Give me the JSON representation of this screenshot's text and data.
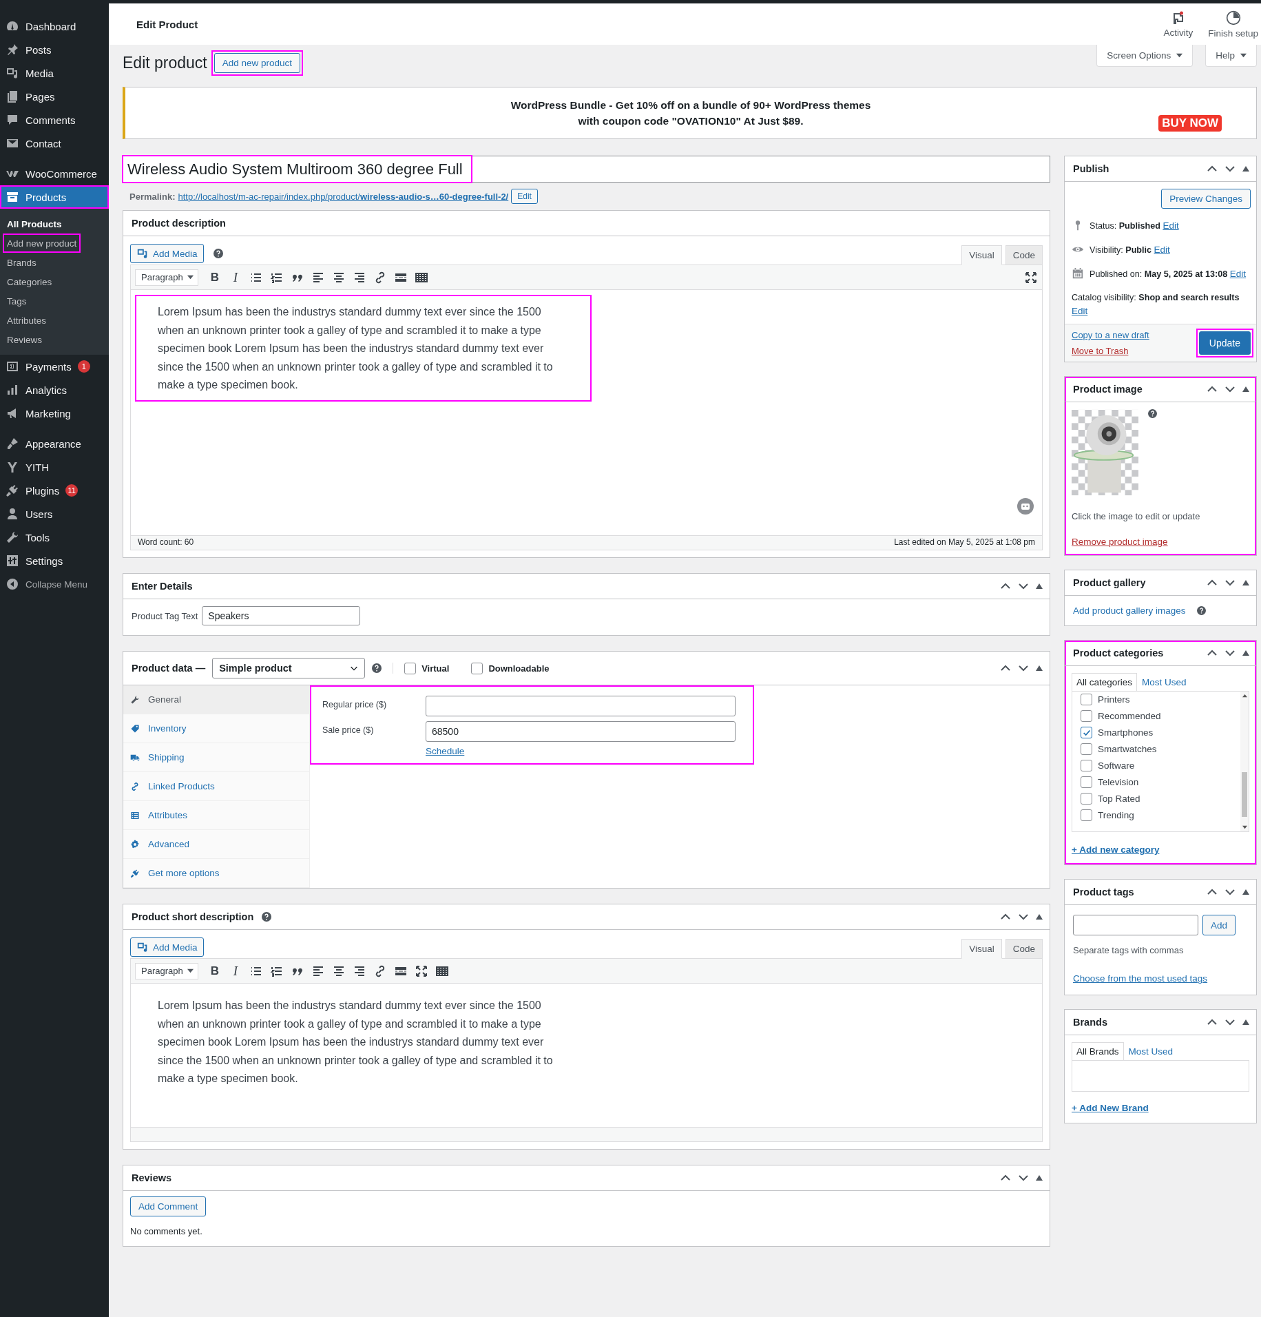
{
  "header": {
    "title": "Edit Product",
    "actions": [
      {
        "label": "Activity",
        "kind": "activity"
      },
      {
        "label": "Finish setup",
        "kind": "setup"
      }
    ]
  },
  "sidebar": {
    "items": [
      {
        "label": "Dashboard",
        "kind": "dashboard",
        "selected": false,
        "outlined": false
      },
      {
        "label": "Posts",
        "kind": "posts",
        "selected": false,
        "outlined": false
      },
      {
        "label": "Media",
        "kind": "media",
        "selected": false,
        "outlined": false
      },
      {
        "label": "Pages",
        "kind": "pages",
        "selected": false,
        "outlined": false
      },
      {
        "label": "Comments",
        "kind": "comments",
        "selected": false,
        "outlined": false
      },
      {
        "label": "Contact",
        "kind": "contact",
        "selected": false,
        "outlined": false
      },
      {
        "label": "WooCommerce",
        "kind": "woocommerce",
        "selected": false,
        "outlined": false
      },
      {
        "label": "Products",
        "kind": "products",
        "selected": true,
        "outlined": true,
        "submenu": [
          {
            "label": "All Products",
            "selected": true,
            "outlined": false
          },
          {
            "label": "Add new product",
            "selected": false,
            "outlined": true
          },
          {
            "label": "Brands",
            "selected": false,
            "outlined": false
          },
          {
            "label": "Categories",
            "selected": false,
            "outlined": false
          },
          {
            "label": "Tags",
            "selected": false,
            "outlined": false
          },
          {
            "label": "Attributes",
            "selected": false,
            "outlined": false
          },
          {
            "label": "Reviews",
            "selected": false,
            "outlined": false
          }
        ]
      },
      {
        "label": "Payments",
        "kind": "payments",
        "selected": false,
        "outlined": false,
        "badge": "1"
      },
      {
        "label": "Analytics",
        "kind": "analytics",
        "selected": false,
        "outlined": false
      },
      {
        "label": "Marketing",
        "kind": "marketing",
        "selected": false,
        "outlined": false
      },
      {
        "label": "Appearance",
        "kind": "appearance",
        "selected": false,
        "outlined": false
      },
      {
        "label": "YITH",
        "kind": "yith",
        "selected": false,
        "outlined": false
      },
      {
        "label": "Plugins",
        "kind": "plugins",
        "selected": false,
        "outlined": false,
        "badge": "11"
      },
      {
        "label": "Users",
        "kind": "users",
        "selected": false,
        "outlined": false
      },
      {
        "label": "Tools",
        "kind": "tools",
        "selected": false,
        "outlined": false
      },
      {
        "label": "Settings",
        "kind": "settings",
        "selected": false,
        "outlined": false
      },
      {
        "label": "Collapse Menu",
        "kind": "collapse",
        "selected": false,
        "outlined": false
      }
    ]
  },
  "page": {
    "heading": "Edit product",
    "add_button": "Add new product",
    "add_button_outlined": true,
    "screen_options": "Screen Options",
    "help": "Help"
  },
  "banner": {
    "line_1": "WordPress Bundle - Get 10% off on a bundle of 90+ WordPress themes",
    "line_2": "with coupon code \"OVATION10\" At Just $89.",
    "button": "BUY NOW"
  },
  "title_field": {
    "value": "Wireless Audio System Multiroom 360 degree Full",
    "outlined": true
  },
  "permalink": {
    "label": "Permalink:",
    "url": "http://localhost/m-ac-repair/index.php/product/**wireless-audio-s…60-degree-full-2/**",
    "button": "Edit"
  },
  "description": {
    "title": "Product description",
    "add_media": "Add Media",
    "tabs": [
      {
        "label": "Visual",
        "selected": true
      },
      {
        "label": "Code",
        "selected": false
      }
    ],
    "format": "Paragraph",
    "toolbar": [
      {
        "kind": "bold",
        "glyph": "B"
      },
      {
        "kind": "italic",
        "glyph": "I"
      },
      {
        "kind": "bullets"
      },
      {
        "kind": "numbers"
      },
      {
        "kind": "quote"
      },
      {
        "kind": "align-left"
      },
      {
        "kind": "align-center"
      },
      {
        "kind": "align-right"
      },
      {
        "kind": "link"
      },
      {
        "kind": "more"
      },
      {
        "kind": "kitchen"
      }
    ],
    "text": "Lorem Ipsum has been the industrys standard dummy text ever since the 1500 when an unknown printer took a galley of type and scrambled it to make a type specimen book Lorem Ipsum has been the industrys standard dummy text ever since the 1500 when an unknown printer took a galley of type and scrambled it to make a type specimen book.",
    "outlined": true,
    "word_count": "Word count: 60",
    "last_edited": "Last edited on May 5, 2025 at 1:08 pm"
  },
  "enter_details": {
    "title": "Enter Details",
    "field_label": "Product Tag Text",
    "field_value": "Speakers"
  },
  "product_data": {
    "title": "Product data —",
    "type": "Simple product",
    "options": [
      {
        "label": "Virtual",
        "checked": false
      },
      {
        "label": "Downloadable",
        "checked": false
      }
    ],
    "tabs": [
      {
        "label": "General",
        "kind": "general",
        "selected": true
      },
      {
        "label": "Inventory",
        "kind": "inventory",
        "selected": false
      },
      {
        "label": "Shipping",
        "kind": "shipping",
        "selected": false
      },
      {
        "label": "Linked Products",
        "kind": "linked",
        "selected": false
      },
      {
        "label": "Attributes",
        "kind": "attributes",
        "selected": false
      },
      {
        "label": "Advanced",
        "kind": "advanced",
        "selected": false
      },
      {
        "label": "Get more options",
        "kind": "more",
        "selected": false
      }
    ],
    "fields": [
      {
        "label": "Regular price ($)"
      },
      {
        "label": "Sale price ($)",
        "value": "68500",
        "link": "Schedule"
      }
    ],
    "outlined": true
  },
  "short_description": {
    "title": "Product short description",
    "add_media": "Add Media",
    "tabs": [
      {
        "label": "Visual",
        "selected": true
      },
      {
        "label": "Code",
        "selected": false
      }
    ],
    "format": "Paragraph",
    "toolbar": [
      {
        "kind": "bold",
        "glyph": "B"
      },
      {
        "kind": "italic",
        "glyph": "I"
      },
      {
        "kind": "bullets"
      },
      {
        "kind": "numbers"
      },
      {
        "kind": "quote"
      },
      {
        "kind": "align-left"
      },
      {
        "kind": "align-center"
      },
      {
        "kind": "align-right"
      },
      {
        "kind": "link"
      },
      {
        "kind": "more"
      },
      {
        "kind": "fullscreen"
      },
      {
        "kind": "kitchen"
      }
    ],
    "text": "Lorem Ipsum has been the industrys standard dummy text ever since the 1500 when an unknown printer took a galley of type and scrambled it to make a type specimen book Lorem Ipsum has been the industrys standard dummy text ever since the 1500 when an unknown printer took a galley of type and scrambled it to make a type specimen book."
  },
  "reviews": {
    "title": "Reviews",
    "button": "Add Comment",
    "empty": "No comments yet."
  },
  "publish": {
    "title": "Publish",
    "preview": "Preview Changes",
    "rows": [
      {
        "kind": "status",
        "label": "Status:",
        "value": "Published",
        "link": "Edit"
      },
      {
        "kind": "visibility",
        "label": "Visibility:",
        "value": "Public",
        "link": "Edit"
      },
      {
        "kind": "date",
        "label": "Published on:",
        "value": "May 5, 2025 at 13:08",
        "link": "Edit"
      },
      {
        "kind": "catalog",
        "label": "Catalog visibility:",
        "value": "Shop and search results",
        "link": "Edit"
      }
    ],
    "copy": "Copy to a new draft",
    "trash": "Move to Trash",
    "update": "Update",
    "update_outlined": true
  },
  "product_image": {
    "title": "Product image",
    "hint": "Click the image to edit or update",
    "remove": "Remove product image",
    "outlined": true
  },
  "gallery": {
    "title": "Product gallery",
    "link": "Add product gallery images"
  },
  "categories": {
    "title": "Product categories",
    "tabs": [
      {
        "label": "All categories",
        "selected": true
      },
      {
        "label": "Most Used",
        "selected": false
      }
    ],
    "items": [
      {
        "label": "Printers",
        "checked": false
      },
      {
        "label": "Recommended",
        "checked": false
      },
      {
        "label": "Smartphones",
        "checked": true
      },
      {
        "label": "Smartwatches",
        "checked": false
      },
      {
        "label": "Software",
        "checked": false
      },
      {
        "label": "Television",
        "checked": false
      },
      {
        "label": "Top Rated",
        "checked": false
      },
      {
        "label": "Trending",
        "checked": false
      }
    ],
    "add": "+ Add new category",
    "outlined": true
  },
  "tags": {
    "title": "Product tags",
    "button": "Add",
    "hint": "Separate tags with commas",
    "link": "Choose from the most used tags"
  },
  "brands": {
    "title": "Brands",
    "tabs": [
      {
        "label": "All Brands",
        "selected": true
      },
      {
        "label": "Most Used",
        "selected": false
      }
    ],
    "add": "+ Add New Brand"
  }
}
